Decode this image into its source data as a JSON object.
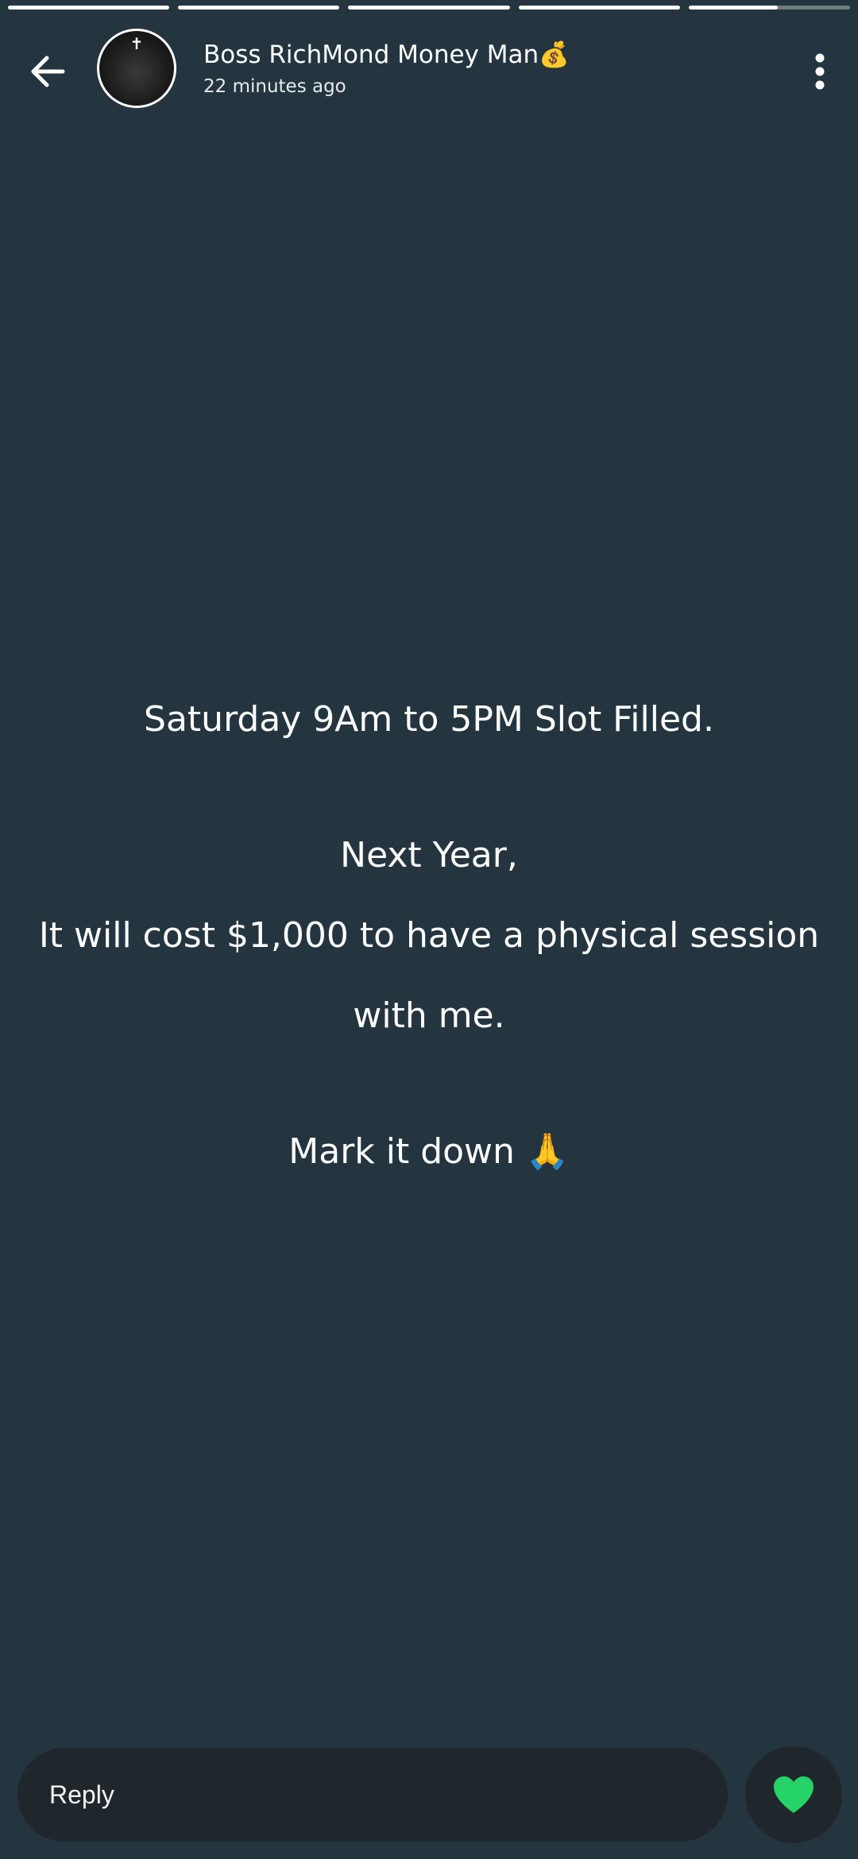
{
  "progress": [
    {
      "fill": 1.0
    },
    {
      "fill": 1.0
    },
    {
      "fill": 1.0
    },
    {
      "fill": 1.0
    },
    {
      "fill": 0.55
    }
  ],
  "header": {
    "name": "Boss RichMond Money Man💰",
    "time": "22 minutes ago",
    "back_icon": "arrow-left-icon",
    "menu_icon": "more-vertical-icon"
  },
  "story": {
    "line1": "Saturday 9Am to 5PM Slot Filled.",
    "line2": "Next Year,",
    "line3": "It will cost $1,000 to have a physical session",
    "line4": "with me.",
    "line5": "Mark it down 🙏"
  },
  "reply": {
    "placeholder": "Reply",
    "like_icon": "heart-icon",
    "like_color": "#25d366"
  },
  "colors": {
    "background": "#243540",
    "input_background": "#1f272c"
  }
}
